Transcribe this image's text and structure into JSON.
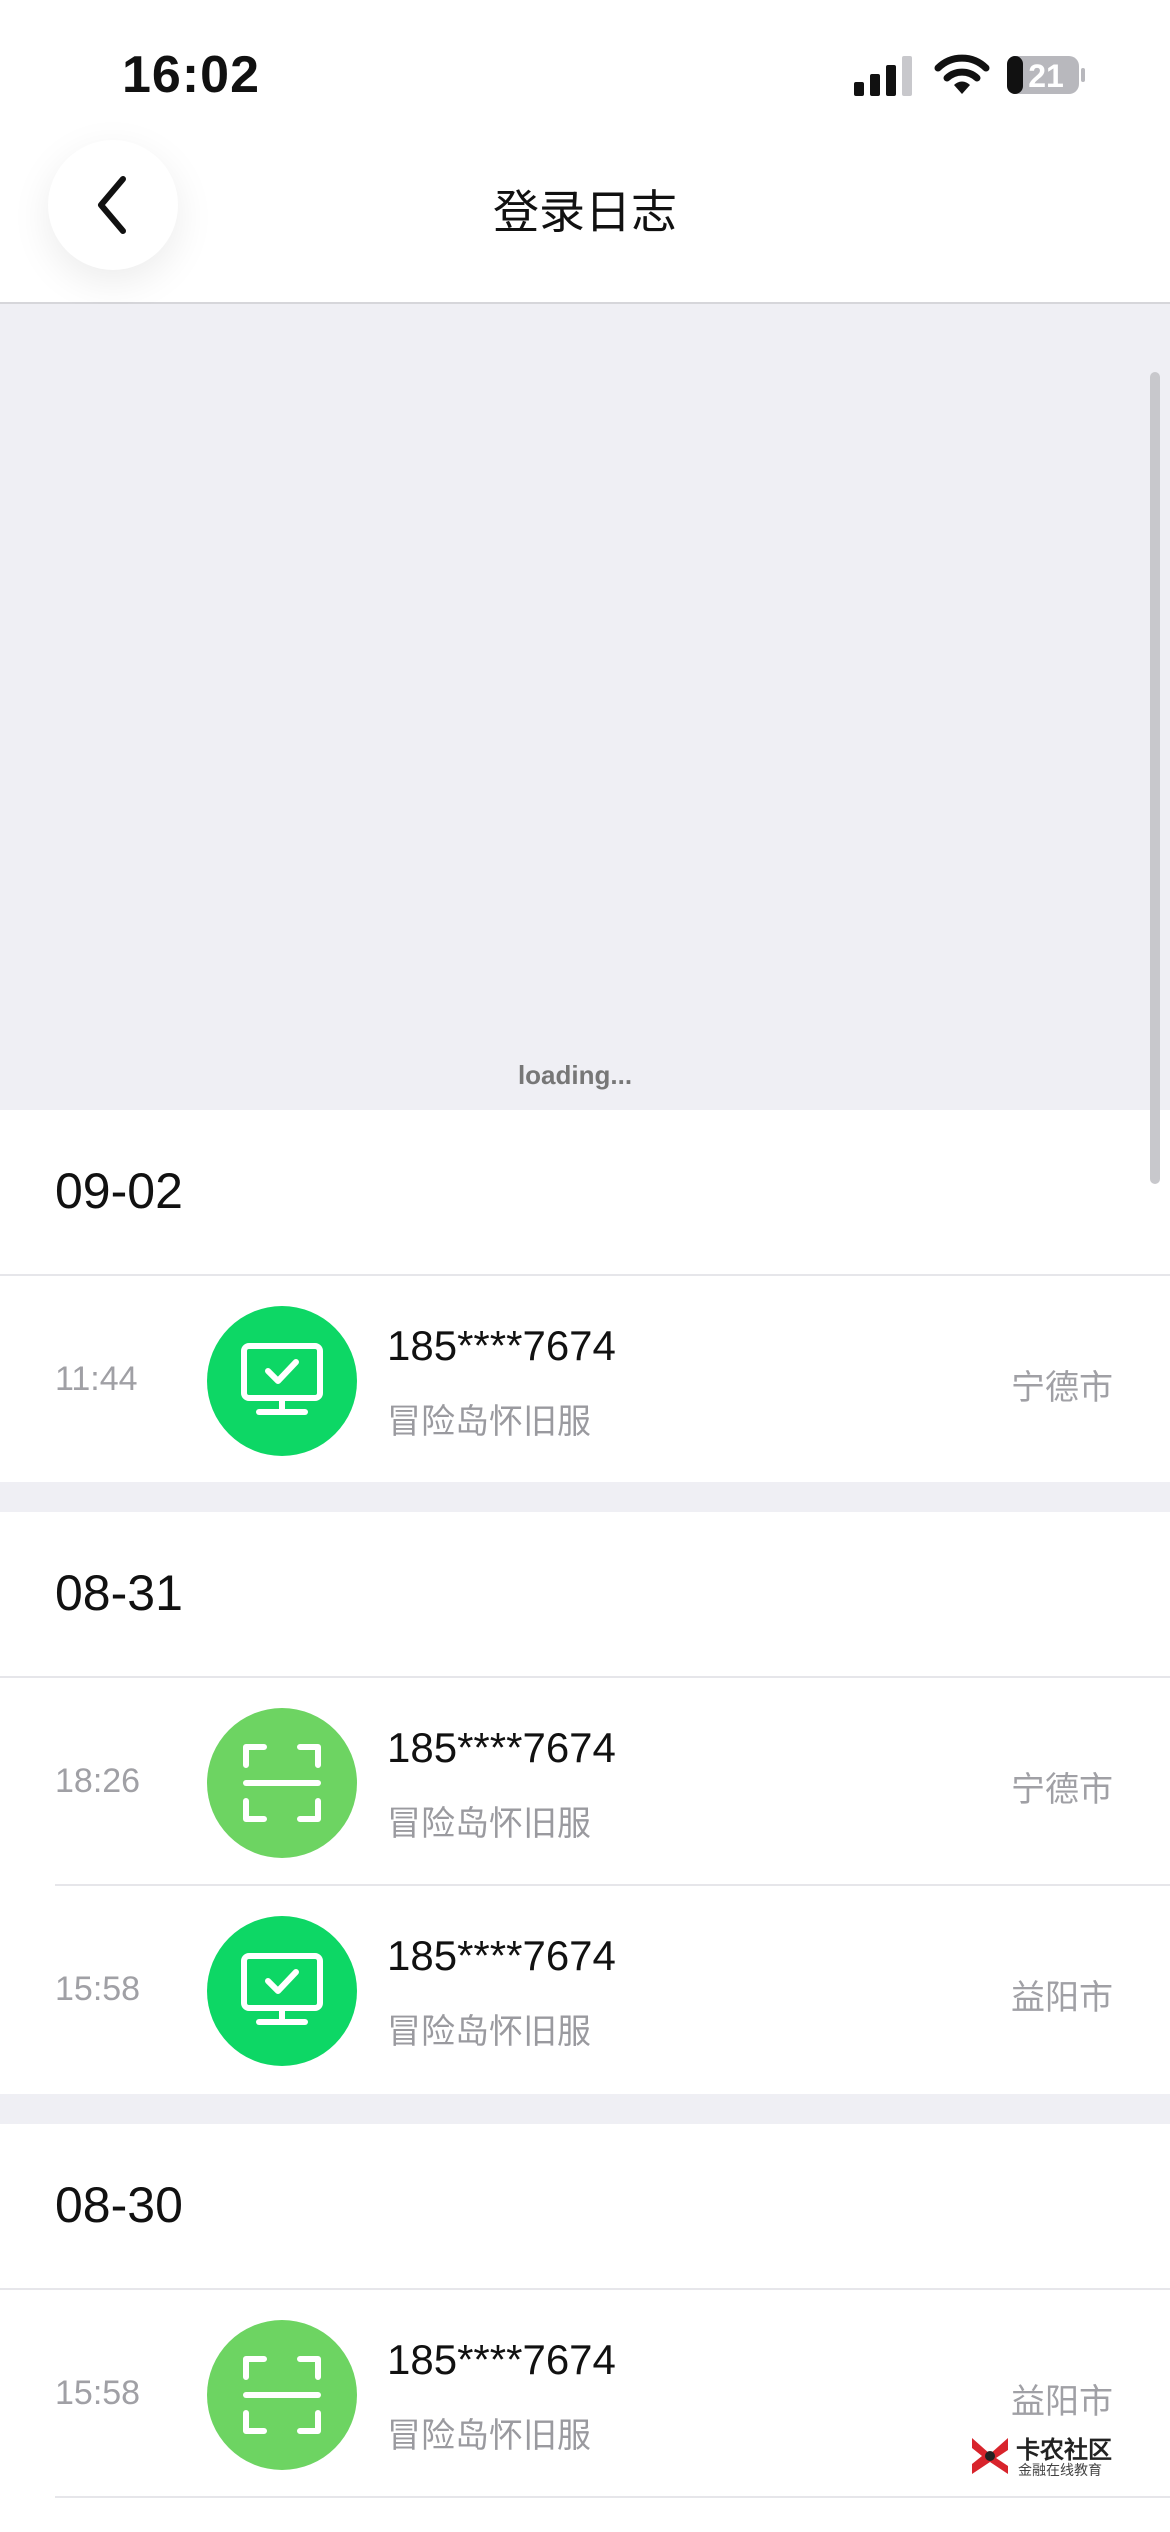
{
  "status_bar": {
    "time": "16:02",
    "battery_level": "21"
  },
  "nav": {
    "title": "登录日志",
    "back_icon": "chevron-left-icon"
  },
  "loading": {
    "text": "loading..."
  },
  "colors": {
    "pc_green": "#0dd765",
    "scan_green": "#6dd462",
    "page_bg": "#efeff4"
  },
  "sections": [
    {
      "date": "09-02",
      "entries": [
        {
          "time": "11:44",
          "icon": "monitor-check-icon",
          "account": "185****7674",
          "app": "冒险岛怀旧服",
          "city": "宁德市"
        }
      ]
    },
    {
      "date": "08-31",
      "entries": [
        {
          "time": "18:26",
          "icon": "scan-frame-icon",
          "account": "185****7674",
          "app": "冒险岛怀旧服",
          "city": "宁德市"
        },
        {
          "time": "15:58",
          "icon": "monitor-check-icon",
          "account": "185****7674",
          "app": "冒险岛怀旧服",
          "city": "益阳市"
        }
      ]
    },
    {
      "date": "08-30",
      "entries": [
        {
          "time": "15:58",
          "icon": "scan-frame-icon",
          "account": "185****7674",
          "app": "冒险岛怀旧服",
          "city": "益阳市"
        }
      ]
    }
  ],
  "watermark": {
    "title": "卡农社区",
    "subtitle": "金融在线教育"
  }
}
